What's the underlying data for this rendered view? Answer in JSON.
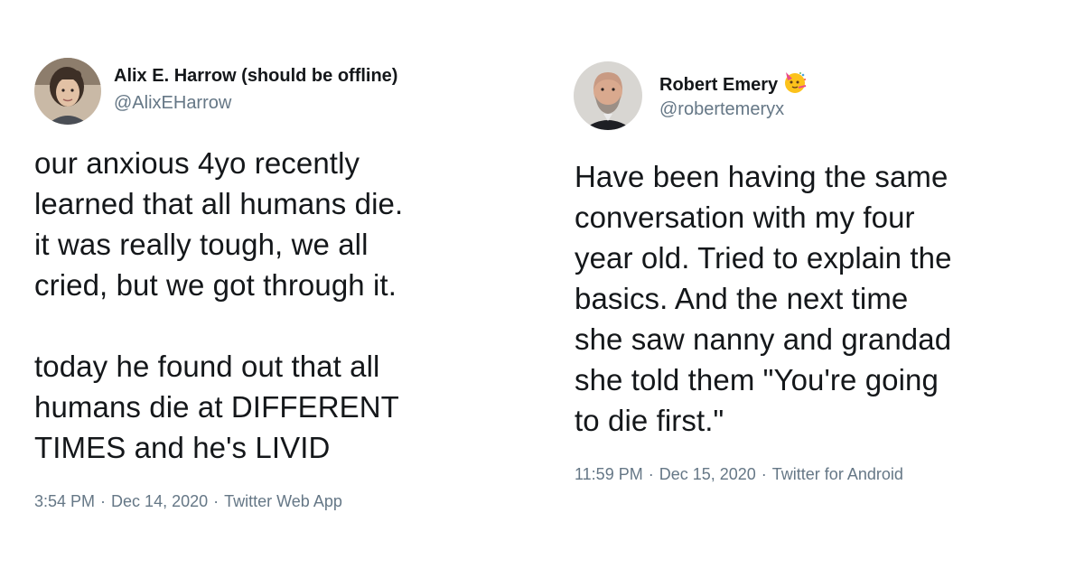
{
  "tweets": [
    {
      "display_name": "Alix E. Harrow (should be offline)",
      "handle": "@AlixEHarrow",
      "text": "our anxious 4yo recently\nlearned that all humans die.\nit was really tough, we all\ncried, but we got through it.\n\ntoday he found out that all\nhumans die at DIFFERENT\nTIMES and he's LIVID",
      "time": "3:54 PM",
      "date": "Dec 14, 2020",
      "source": "Twitter Web App",
      "separator": "·"
    },
    {
      "display_name": "Robert Emery",
      "name_emoji": "partying-face-emoji",
      "handle": "@robertemeryx",
      "text": "Have been having the same\nconversation with my four\nyear old. Tried to explain the\nbasics. And the next time\nshe saw nanny and grandad\nshe told them \"You're going\nto die first.\"",
      "time": "11:59 PM",
      "date": "Dec 15, 2020",
      "source": "Twitter for Android",
      "separator": "·"
    }
  ],
  "colors": {
    "text": "#14171a",
    "secondary": "#657786",
    "background": "#ffffff"
  }
}
